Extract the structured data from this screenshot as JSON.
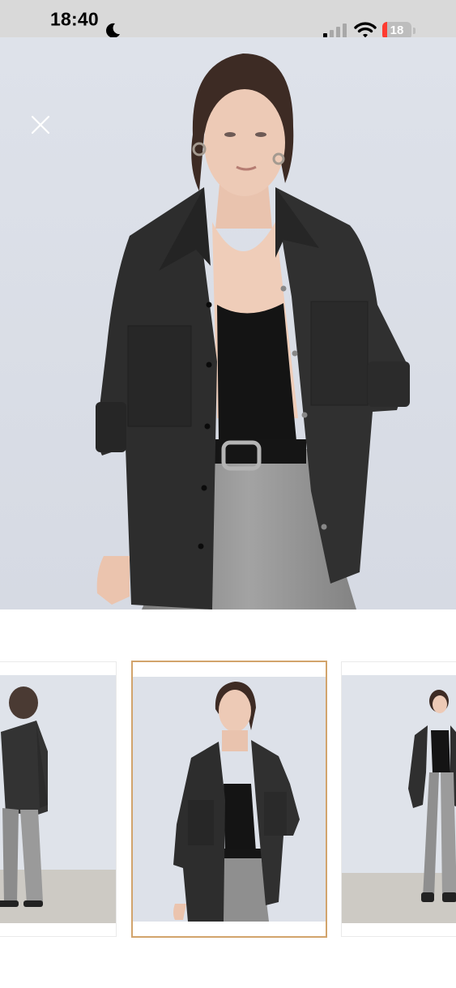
{
  "status_bar": {
    "time": "18:40",
    "battery_level": "18",
    "battery_fraction": 0.18,
    "icons": [
      "moon-icon",
      "cellular-signal-icon",
      "wifi-icon",
      "battery-icon"
    ]
  },
  "viewer": {
    "close_icon": "close-icon",
    "main_image": "model-black-overshirt-front",
    "thumbnails": [
      {
        "image": "model-black-overshirt-back",
        "selected": false
      },
      {
        "image": "model-black-overshirt-front",
        "selected": true
      },
      {
        "image": "model-black-overshirt-full-length",
        "selected": false
      }
    ],
    "colors": {
      "selected_border": "#d2a46c",
      "background": "#dfe3ea",
      "status_bar": "#d9d9d9"
    }
  }
}
